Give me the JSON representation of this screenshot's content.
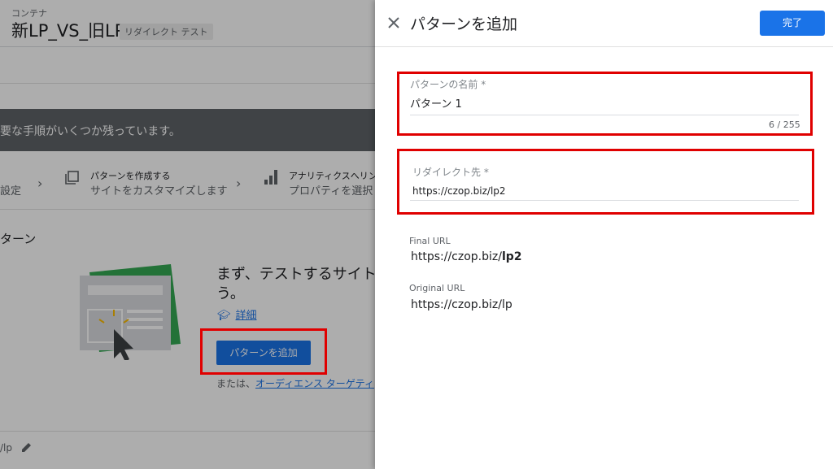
{
  "background": {
    "container_label": "コンテナ",
    "container_title": "新LP_VS_旧LP",
    "container_badge": "リダイレクト テスト",
    "notice": "要な手順がいくつか残っています。",
    "steps": [
      {
        "title": "",
        "subtitle": "設定"
      },
      {
        "title": "パターンを作成する",
        "subtitle": "サイトをカスタマイズします"
      },
      {
        "title": "アナリティクスへリン",
        "subtitle": "プロパティを選択し"
      }
    ],
    "section_title": "ターン",
    "empty_state": {
      "title_line1": "まず、テストするサイトの",
      "title_line2": "う。",
      "detail_link": "詳細",
      "add_button": "パターンを追加",
      "alt_prefix": "または、",
      "alt_link": "オーディエンス ターゲティ"
    },
    "footer_url": "/lp"
  },
  "panel": {
    "title": "パターンを追加",
    "done_button": "完了",
    "name_field": {
      "label": "パターンの名前 *",
      "value": "パターン 1",
      "counter": "6 / 255"
    },
    "redirect_field": {
      "label": "リダイレクト先 *",
      "value": "https://czop.biz/lp2"
    },
    "final_url": {
      "label": "Final URL",
      "prefix": "https://czop.biz/",
      "suffix": "lp2"
    },
    "original_url": {
      "label": "Original URL",
      "value": "https://czop.biz/lp"
    }
  },
  "colors": {
    "primary": "#1a73e8",
    "highlight": "#e00000",
    "notice_bg": "#5f6368"
  }
}
